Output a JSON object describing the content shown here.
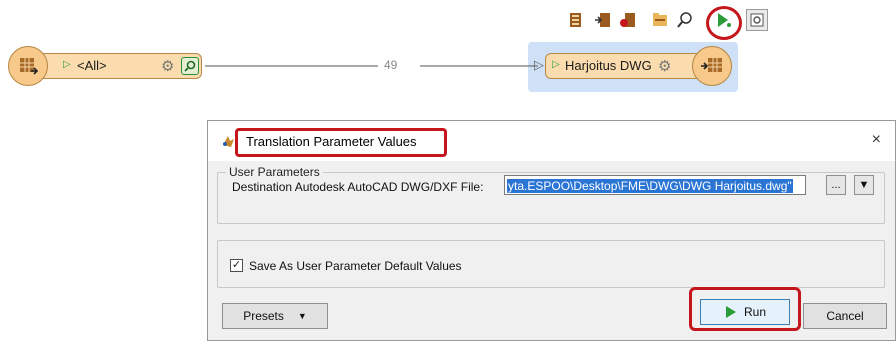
{
  "canvas": {
    "source_node_label": "<All>",
    "connection_count": "49",
    "dest_node_label": "Harjoitus DWG",
    "toolbar_icons": [
      "add-reader-icon",
      "add-writer-icon",
      "remove-icon",
      "feature-types-icon",
      "inspect-icon",
      "run-icon",
      "zoom-icon"
    ]
  },
  "dialog": {
    "title": "Translation Parameter Values",
    "close_glyph": "×",
    "group_title": "User Parameters",
    "param_label": "Destination Autodesk AutoCAD DWG/DXF File:",
    "param_value": "yta.ESPOO\\Desktop\\FME\\DWG\\DWG Harjoitus.dwg\"",
    "browse_label": "...",
    "save_default_checked": true,
    "save_default_label": "Save As User Parameter Default Values",
    "presets_label": "Presets",
    "run_label": "Run",
    "cancel_label": "Cancel"
  },
  "colors": {
    "highlight": "#c4161c",
    "node_fill": "#fbdcae",
    "selection": "#cfe1f7",
    "input_selection": "#2a74d4"
  }
}
